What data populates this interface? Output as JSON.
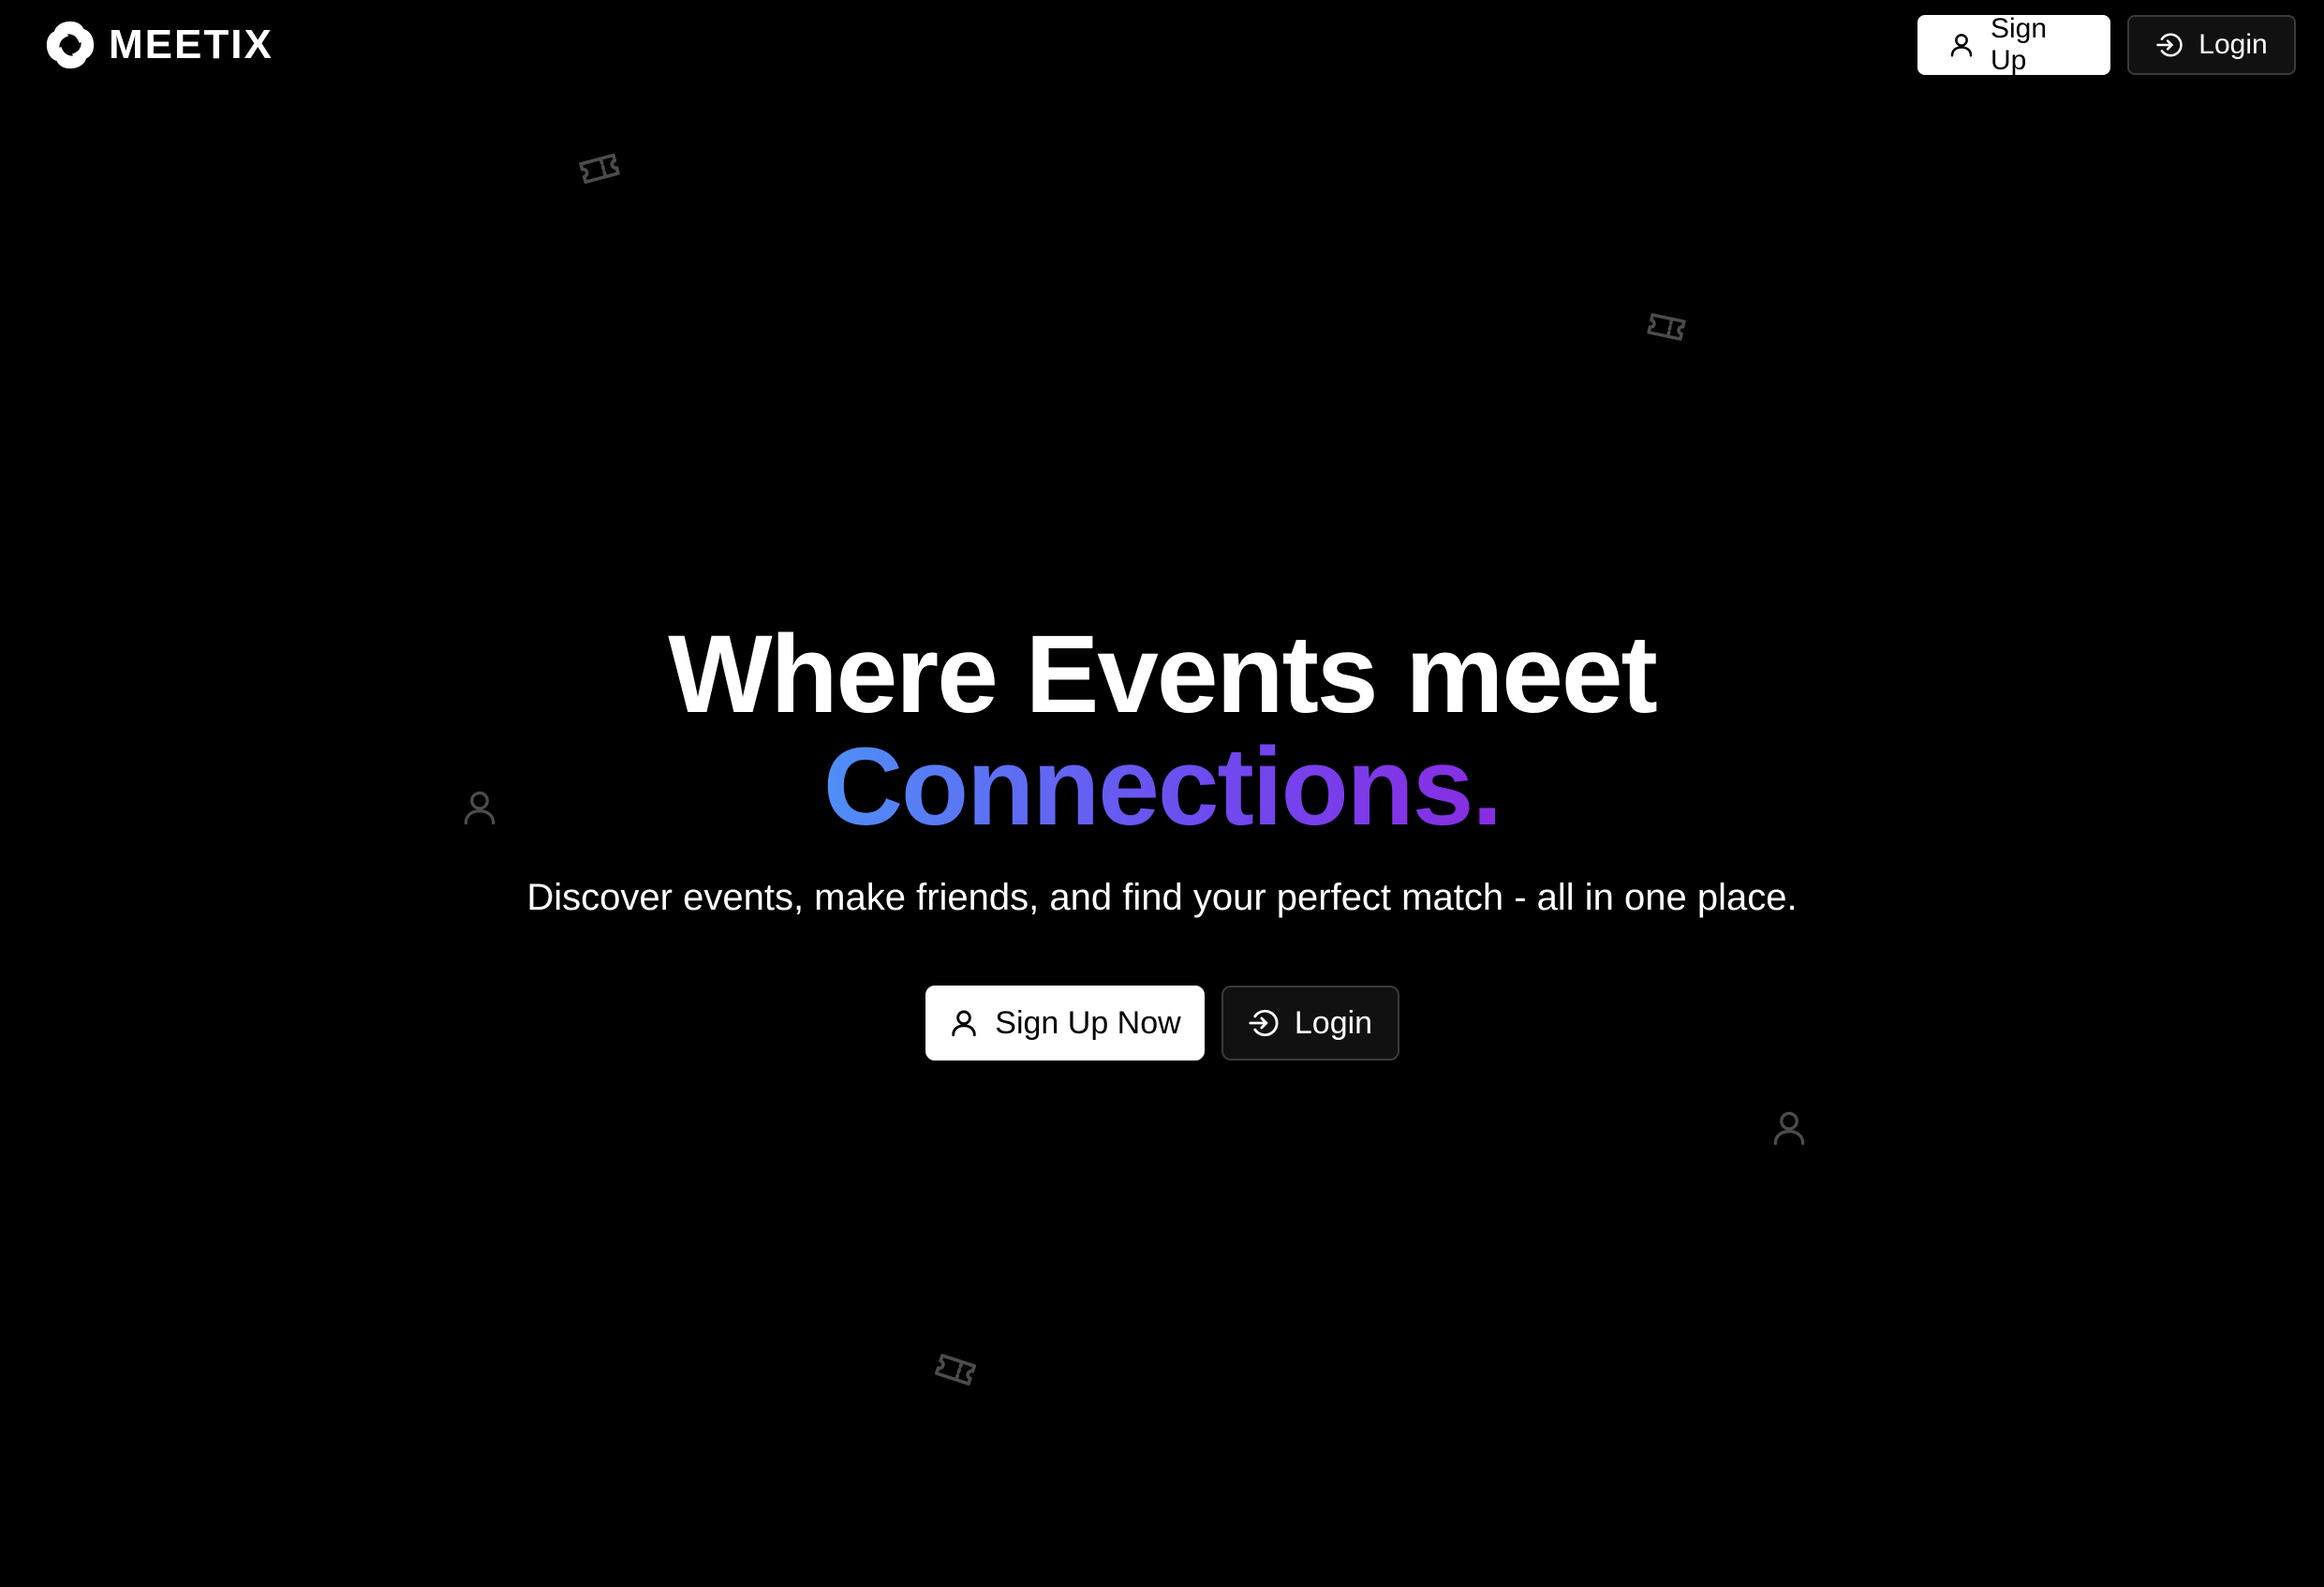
{
  "brand": {
    "name": "MEETIX"
  },
  "nav": {
    "signup_label": "Sign Up",
    "login_label": "Login"
  },
  "hero": {
    "title_line1": "Where Events meet",
    "title_line2": "Connections.",
    "subtitle": "Discover events, make friends, and find your perfect match - all in one place.",
    "signup_label": "Sign Up Now",
    "login_label": "Login"
  },
  "colors": {
    "background": "#000000",
    "gradient_start": "#4f8ff7",
    "gradient_end": "#8a2be2",
    "button_light": "#ffffff",
    "button_dark": "#111111"
  },
  "icons": {
    "logo": "meetix-logo-icon",
    "user": "user-icon",
    "login": "login-icon",
    "decorations": [
      "ticket-icon",
      "ticket-icon",
      "user-icon",
      "user-icon",
      "ticket-icon"
    ]
  }
}
